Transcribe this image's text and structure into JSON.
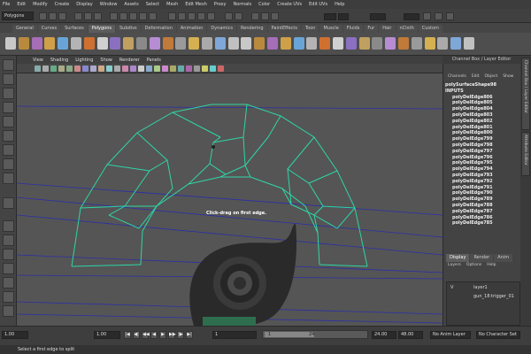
{
  "menubar": [
    "File",
    "Edit",
    "Modify",
    "Create",
    "Display",
    "Window",
    "Assets",
    "Select",
    "Mesh",
    "Edit Mesh",
    "Proxy",
    "Normals",
    "Color",
    "Create UVs",
    "Edit UVs",
    "Help"
  ],
  "status": {
    "mode": "Polygons"
  },
  "shelf_tabs": [
    "General",
    "Curves",
    "Surfaces",
    "Polygons",
    "Subdivs",
    "Deformation",
    "Animation",
    "Dynamics",
    "Rendering",
    "PaintEffects",
    "Toon",
    "Muscle",
    "Fluids",
    "Fur",
    "Hair",
    "nCloth",
    "Custom"
  ],
  "shelf_active": "Polygons",
  "panel_menu": [
    "View",
    "Shading",
    "Lighting",
    "Show",
    "Renderer",
    "Panels"
  ],
  "viewport": {
    "hint": "Click-drag on first edge."
  },
  "channel_box": {
    "title": "Channel Box / Layer Editor",
    "menu": [
      "Channels",
      "Edit",
      "Object",
      "Show"
    ],
    "shape": "polySurfaceShape98",
    "inputs_label": "INPUTS",
    "nodes": [
      "polyDelEdge806",
      "polyDelEdge805",
      "polyDelEdge804",
      "polyDelEdge803",
      "polyDelEdge802",
      "polyDelEdge801",
      "polyDelEdge800",
      "polyDelEdge799",
      "polyDelEdge798",
      "polyDelEdge797",
      "polyDelEdge796",
      "polyDelEdge795",
      "polyDelEdge794",
      "polyDelEdge793",
      "polyDelEdge792",
      "polyDelEdge791",
      "polyDelEdge790",
      "polyDelEdge789",
      "polyDelEdge788",
      "polyDelEdge787",
      "polyDelEdge786",
      "polyDelEdge785"
    ]
  },
  "side_tabs": [
    "Channel Box / Layer Editor",
    "Attribute Editor"
  ],
  "layer_editor": {
    "tabs": [
      "Display",
      "Render",
      "Anim"
    ],
    "menu": [
      "Layers",
      "Options",
      "Help"
    ],
    "layers": [
      {
        "visible": "V",
        "name": "layer1"
      },
      {
        "visible": "",
        "name": "gun_18:trigger_01"
      }
    ]
  },
  "timeline": {
    "start": "1.00",
    "current_start": "1.00",
    "range_start": "1",
    "range_end": "24",
    "end_current": "24.00",
    "end": "48.00",
    "anim_layer": "No Anim Layer",
    "char_set": "No Character Set"
  },
  "help_line": "Select a first edge to split",
  "colors": {
    "wire": "#2ed6a6",
    "bg": "#555555",
    "grid": "#2b2ea8"
  }
}
